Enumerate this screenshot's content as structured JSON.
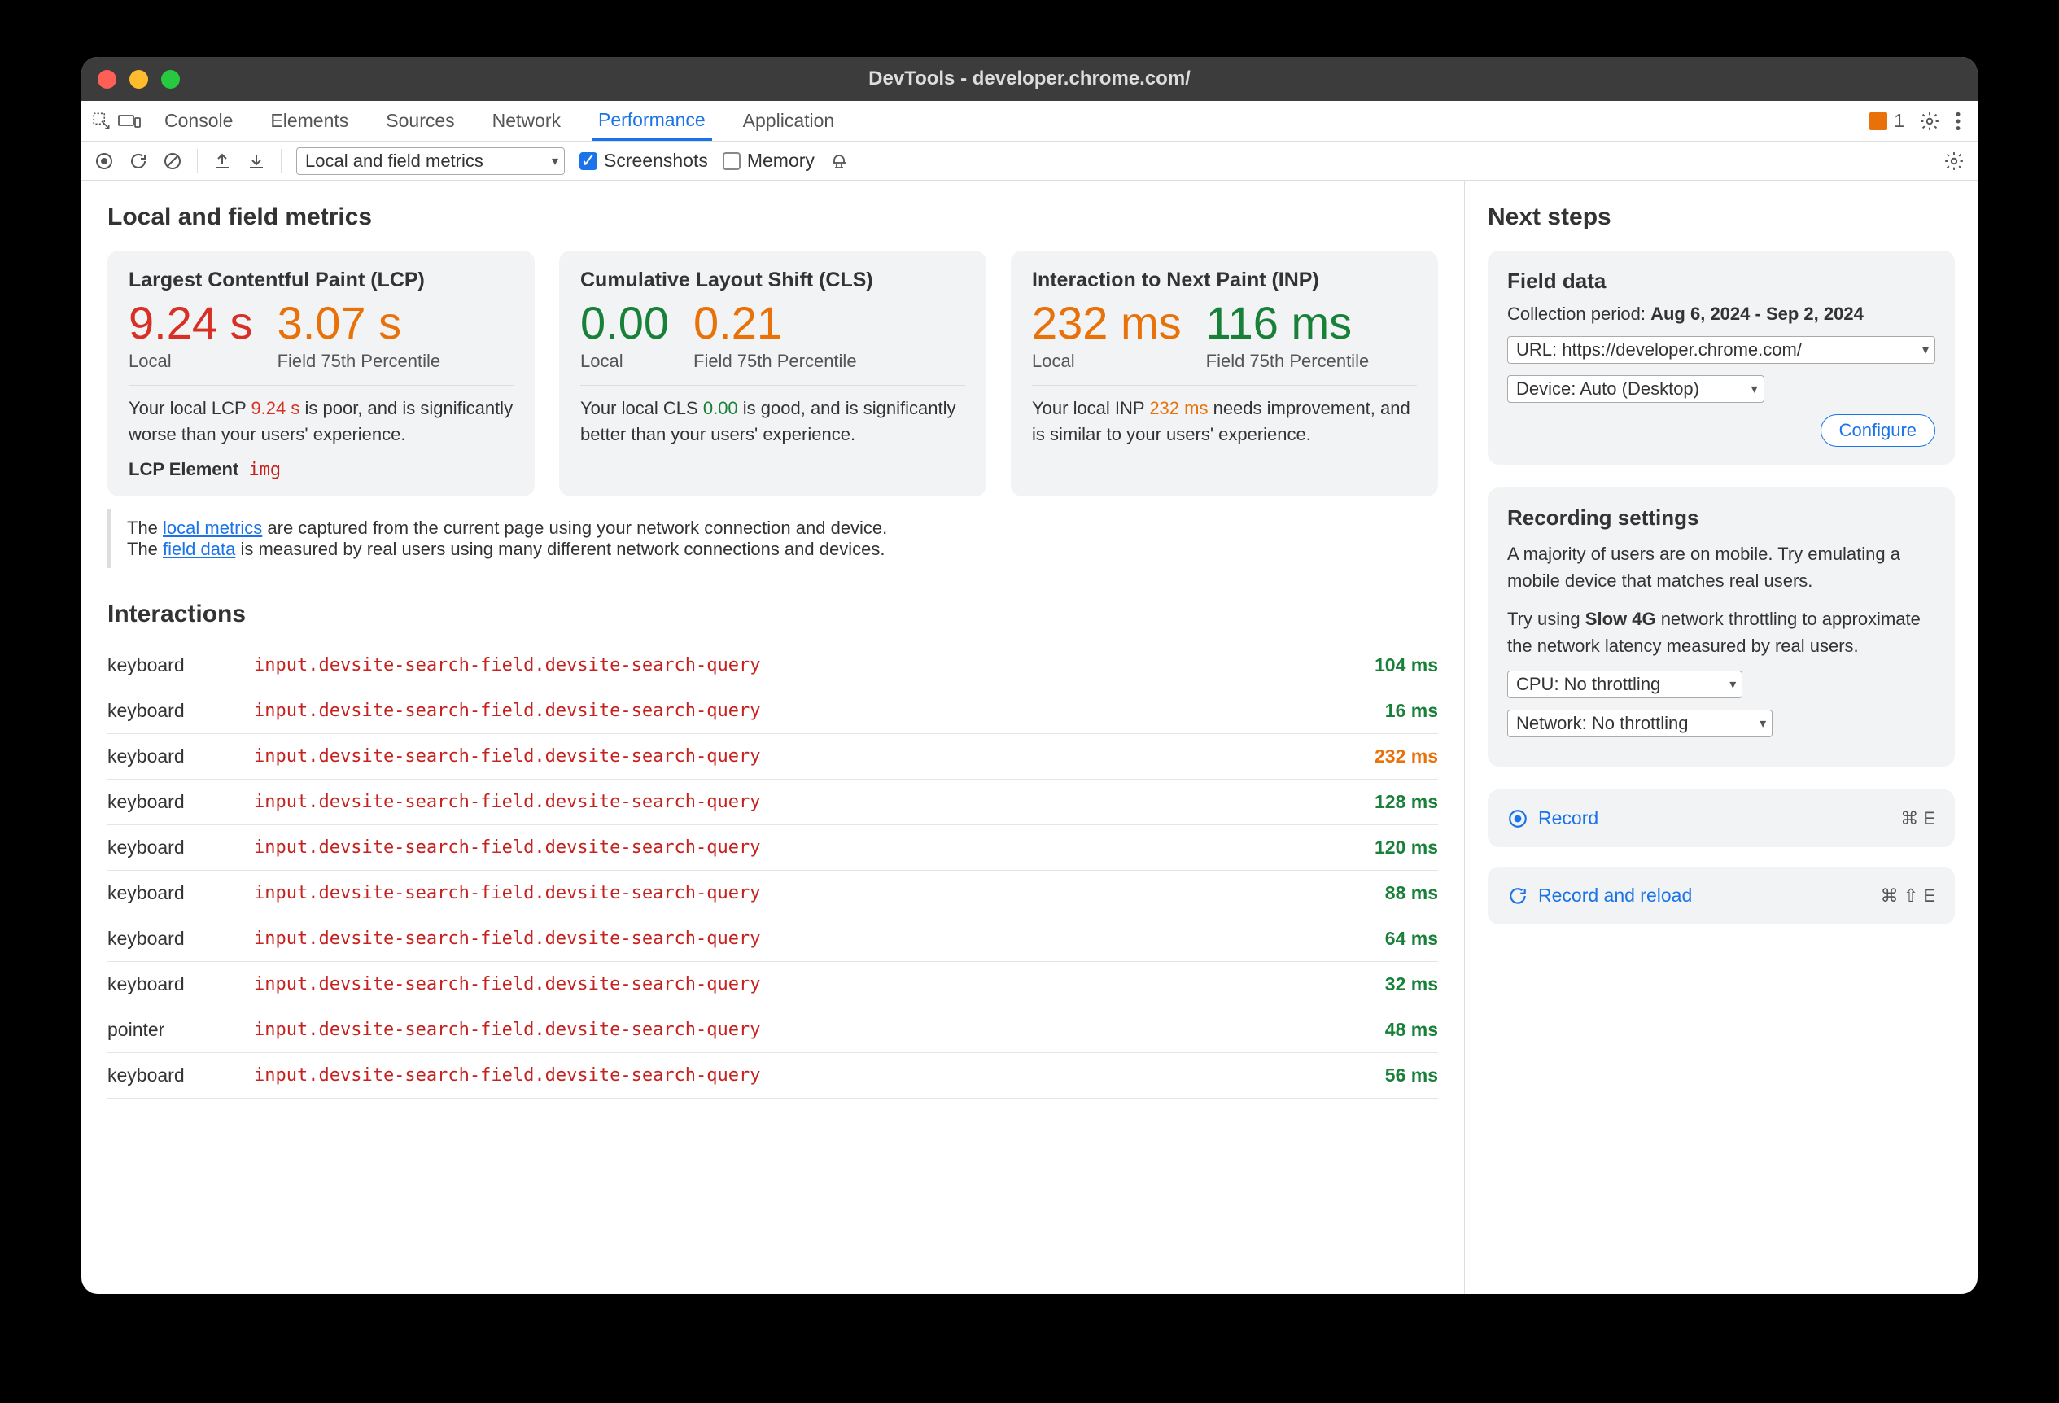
{
  "window": {
    "title": "DevTools - developer.chrome.com/"
  },
  "tabs": {
    "items": [
      "Console",
      "Elements",
      "Sources",
      "Network",
      "Performance",
      "Application"
    ],
    "active_index": 4,
    "issues_count": "1"
  },
  "toolbar": {
    "mode": "Local and field metrics",
    "screenshots_checked": true,
    "screenshots_label": "Screenshots",
    "memory_checked": false,
    "memory_label": "Memory"
  },
  "main": {
    "heading": "Local and field metrics",
    "cards": {
      "lcp": {
        "title": "Largest Contentful Paint (LCP)",
        "local_value": "9.24 s",
        "local_class": "poor",
        "local_label": "Local",
        "field_value": "3.07 s",
        "field_class": "warn",
        "field_label": "Field 75th Percentile",
        "desc_pre": "Your local LCP ",
        "desc_val": "9.24 s",
        "desc_val_class": "poor",
        "desc_post": " is poor, and is significantly worse than your users' experience.",
        "elem_label": "LCP Element",
        "elem_tag": "img"
      },
      "cls": {
        "title": "Cumulative Layout Shift (CLS)",
        "local_value": "0.00",
        "local_class": "good",
        "local_label": "Local",
        "field_value": "0.21",
        "field_class": "warn",
        "field_label": "Field 75th Percentile",
        "desc_pre": "Your local CLS ",
        "desc_val": "0.00",
        "desc_val_class": "good",
        "desc_post": " is good, and is significantly better than your users' experience."
      },
      "inp": {
        "title": "Interaction to Next Paint (INP)",
        "local_value": "232 ms",
        "local_class": "warn",
        "local_label": "Local",
        "field_value": "116 ms",
        "field_class": "good",
        "field_label": "Field 75th Percentile",
        "desc_pre": "Your local INP ",
        "desc_val": "232 ms",
        "desc_val_class": "warn",
        "desc_post": " needs improvement, and is similar to your users' experience."
      }
    },
    "info": {
      "line1_pre": "The ",
      "line1_link": "local metrics",
      "line1_post": " are captured from the current page using your network connection and device.",
      "line2_pre": "The ",
      "line2_link": "field data",
      "line2_post": " is measured by real users using many different network connections and devices."
    },
    "interactions_heading": "Interactions",
    "interactions": [
      {
        "type": "keyboard",
        "selector": "input.devsite-search-field.devsite-search-query",
        "dur": "104 ms",
        "cls": "good"
      },
      {
        "type": "keyboard",
        "selector": "input.devsite-search-field.devsite-search-query",
        "dur": "16 ms",
        "cls": "good"
      },
      {
        "type": "keyboard",
        "selector": "input.devsite-search-field.devsite-search-query",
        "dur": "232 ms",
        "cls": "warn"
      },
      {
        "type": "keyboard",
        "selector": "input.devsite-search-field.devsite-search-query",
        "dur": "128 ms",
        "cls": "good"
      },
      {
        "type": "keyboard",
        "selector": "input.devsite-search-field.devsite-search-query",
        "dur": "120 ms",
        "cls": "good"
      },
      {
        "type": "keyboard",
        "selector": "input.devsite-search-field.devsite-search-query",
        "dur": "88 ms",
        "cls": "good"
      },
      {
        "type": "keyboard",
        "selector": "input.devsite-search-field.devsite-search-query",
        "dur": "64 ms",
        "cls": "good"
      },
      {
        "type": "keyboard",
        "selector": "input.devsite-search-field.devsite-search-query",
        "dur": "32 ms",
        "cls": "good"
      },
      {
        "type": "pointer",
        "selector": "input.devsite-search-field.devsite-search-query",
        "dur": "48 ms",
        "cls": "good"
      },
      {
        "type": "keyboard",
        "selector": "input.devsite-search-field.devsite-search-query",
        "dur": "56 ms",
        "cls": "good"
      }
    ]
  },
  "side": {
    "heading": "Next steps",
    "field_data": {
      "title": "Field data",
      "period_label": "Collection period: ",
      "period_value": "Aug 6, 2024 - Sep 2, 2024",
      "url_select": "URL: https://developer.chrome.com/",
      "device_select": "Device: Auto (Desktop)",
      "configure": "Configure"
    },
    "recording": {
      "title": "Recording settings",
      "p1_pre": "A majority of users are on mobile. Try emulating a mobile device that matches real users.",
      "p2_pre": "Try using ",
      "p2_bold": "Slow 4G",
      "p2_post": " network throttling to approximate the network latency measured by real users.",
      "cpu_select": "CPU: No throttling",
      "net_select": "Network: No throttling"
    },
    "record": {
      "label": "Record",
      "shortcut": "⌘ E"
    },
    "record_reload": {
      "label": "Record and reload",
      "shortcut": "⌘ ⇧ E"
    }
  }
}
